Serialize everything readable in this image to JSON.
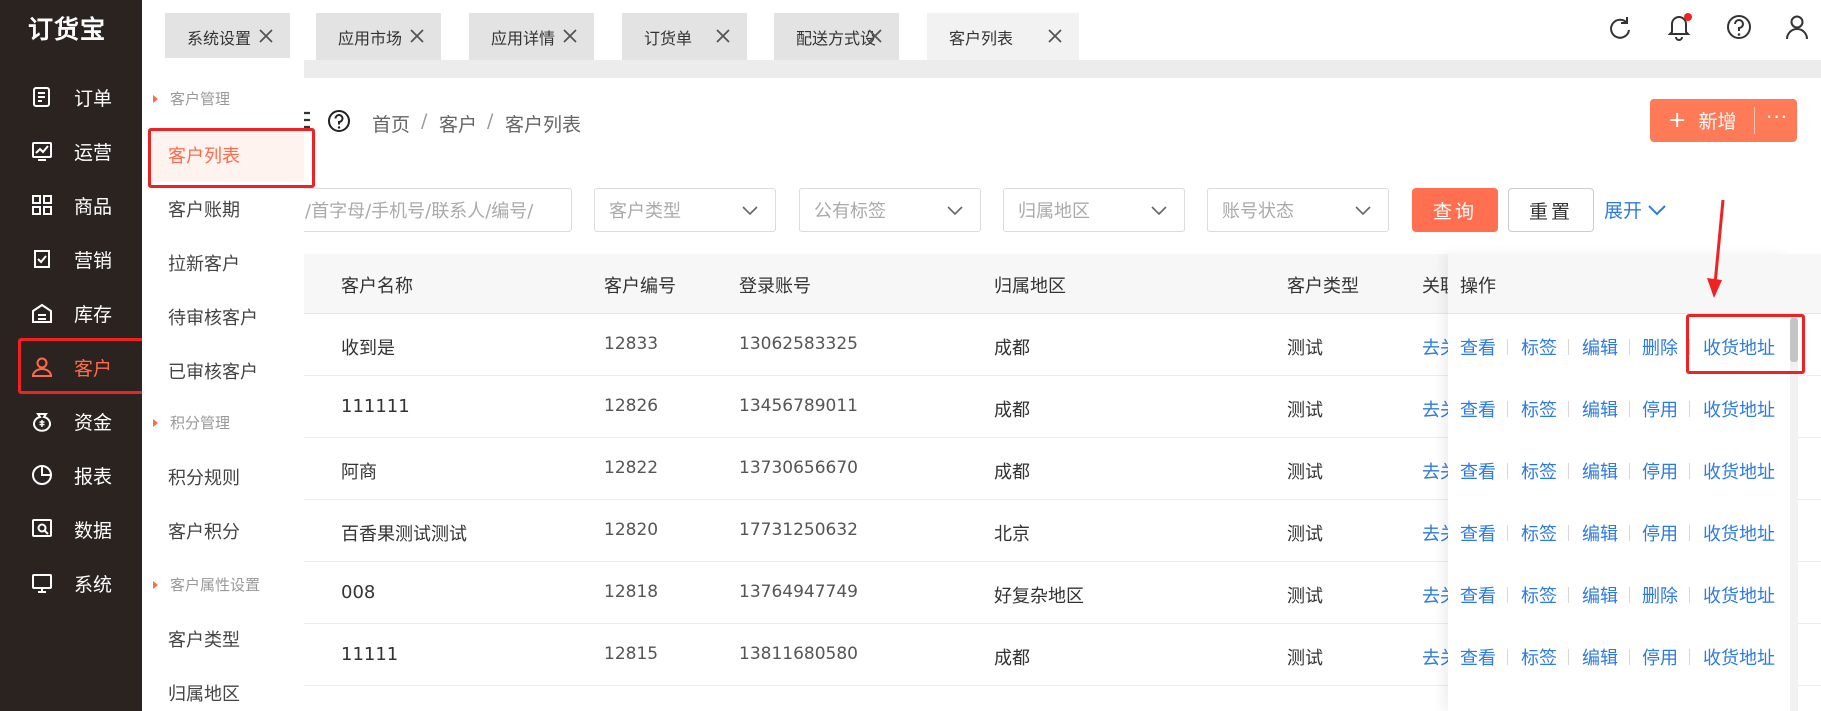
{
  "app": {
    "logo": "订货宝"
  },
  "sidebar": {
    "items": [
      {
        "label": "订单",
        "icon": "order-icon"
      },
      {
        "label": "运营",
        "icon": "operation-chart-icon"
      },
      {
        "label": "商品",
        "icon": "grid-apps-icon"
      },
      {
        "label": "营销",
        "icon": "badge-check-icon"
      },
      {
        "label": "库存",
        "icon": "warehouse-icon"
      },
      {
        "label": "客户",
        "icon": "user-icon",
        "active": true
      },
      {
        "label": "资金",
        "icon": "money-bag-icon"
      },
      {
        "label": "报表",
        "icon": "pie-chart-icon"
      },
      {
        "label": "数据",
        "icon": "data-search-icon"
      },
      {
        "label": "系统",
        "icon": "monitor-icon"
      }
    ]
  },
  "submenu": {
    "groups": [
      "客户管理",
      "积分管理",
      "客户属性设置"
    ],
    "items": [
      "客户列表",
      "客户账期",
      "拉新客户",
      "待审核客户",
      "已审核客户",
      "积分规则",
      "客户积分",
      "客户类型",
      "归属地区"
    ],
    "active": "客户列表"
  },
  "tabs": [
    {
      "label": "系统设置"
    },
    {
      "label": "应用市场"
    },
    {
      "label": "应用详情"
    },
    {
      "label": "订货单"
    },
    {
      "label": "配送方式设"
    },
    {
      "label": "客户列表",
      "active": true
    }
  ],
  "breadcrumb": {
    "home": "首页",
    "sep1": "/",
    "level1": "客户",
    "sep2": "/",
    "current": "客户列表"
  },
  "actions": {
    "new_label": "新增",
    "plus": "+",
    "more": "···"
  },
  "filters": {
    "search_placeholder": "/首字母/手机号/联系人/编号/",
    "customer_type": "客户类型",
    "public_tag": "公有标签",
    "region": "归属地区",
    "account_status": "账号状态",
    "query": "查询",
    "reset": "重置",
    "expand": "展开"
  },
  "table": {
    "headers": {
      "name": "客户名称",
      "code": "客户编号",
      "account": "登录账号",
      "region": "归属地区",
      "type": "客户类型",
      "related": "关联",
      "ops": "操作"
    },
    "rows": [
      {
        "name": "收到是",
        "code": "12833",
        "account": "13062583325",
        "region": "成都",
        "type": "测试",
        "related": "去关",
        "ops": [
          "查看",
          "标签",
          "编辑",
          "删除",
          "收货地址"
        ]
      },
      {
        "name": "111111",
        "code": "12826",
        "account": "13456789011",
        "region": "成都",
        "type": "测试",
        "related": "去关",
        "ops": [
          "查看",
          "标签",
          "编辑",
          "停用",
          "收货地址"
        ]
      },
      {
        "name": "阿商",
        "code": "12822",
        "account": "13730656670",
        "region": "成都",
        "type": "测试",
        "related": "去关",
        "ops": [
          "查看",
          "标签",
          "编辑",
          "停用",
          "收货地址"
        ]
      },
      {
        "name": "百香果测试测试",
        "code": "12820",
        "account": "17731250632",
        "region": "北京",
        "type": "测试",
        "related": "去关",
        "ops": [
          "查看",
          "标签",
          "编辑",
          "停用",
          "收货地址"
        ]
      },
      {
        "name": "008",
        "code": "12818",
        "account": "13764947749",
        "region": "好复杂地区",
        "type": "测试",
        "related": "去关",
        "ops": [
          "查看",
          "标签",
          "编辑",
          "删除",
          "收货地址"
        ]
      },
      {
        "name": "11111",
        "code": "12815",
        "account": "13811680580",
        "region": "成都",
        "type": "测试",
        "related": "去关",
        "ops": [
          "查看",
          "标签",
          "编辑",
          "停用",
          "收货地址"
        ]
      }
    ]
  },
  "colors": {
    "accent": "#ff6b4a",
    "link": "#2d7be0",
    "sidebar_bg": "#2b2320",
    "highlight": "#ee2222"
  }
}
